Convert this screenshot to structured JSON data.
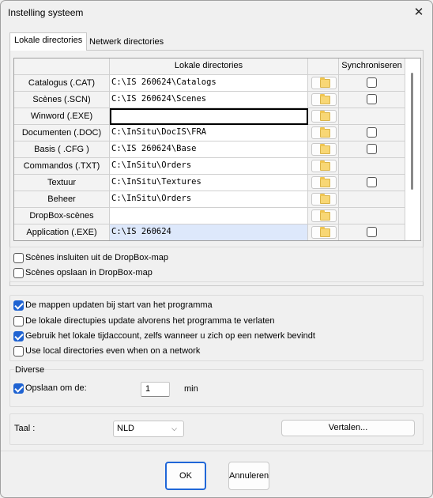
{
  "window": {
    "title": "Instelling systeem",
    "close_glyph": "✕"
  },
  "tabs": [
    {
      "label": "Lokale directories",
      "active": true
    },
    {
      "label": "Netwerk directories",
      "active": false
    }
  ],
  "grid": {
    "col_header_dirs": "Lokale directories",
    "col_header_sync": "Synchroniseren",
    "rows": [
      {
        "label": "Catalogus (.CAT)",
        "value": "C:\\IS 260624\\Catalogs",
        "sync": true
      },
      {
        "label": "Scènes (.SCN)",
        "value": "C:\\IS 260624\\Scenes",
        "sync": true
      },
      {
        "label": "Winword (.EXE)",
        "value": "",
        "sync": false
      },
      {
        "label": "Documenten (.DOC)",
        "value": "C:\\InSitu\\DocIS\\FRA",
        "sync": true
      },
      {
        "label": "Basis ( .CFG )",
        "value": "C:\\IS 260624\\Base",
        "sync": true
      },
      {
        "label": "Commandos (.TXT)",
        "value": "C:\\InSitu\\Orders",
        "sync": false
      },
      {
        "label": "Textuur",
        "value": "C:\\InSitu\\Textures",
        "sync": true
      },
      {
        "label": "Beheer",
        "value": "C:\\InSitu\\Orders",
        "sync": false
      },
      {
        "label": "DropBox-scènes",
        "value": "",
        "sync": false
      },
      {
        "label": "Application (.EXE)",
        "value": "C:\\IS 260624",
        "sync": true
      }
    ],
    "folder_icon": "folder-icon"
  },
  "dropbox": {
    "include_label": "Scènes insluiten uit de DropBox-map",
    "include_checked": false,
    "save_label": "Scènes opslaan in DropBox-map",
    "save_checked": false
  },
  "options": [
    {
      "label": "De mappen updaten bij start van het programma",
      "checked": true
    },
    {
      "label": "De lokale directupies update alvorens het programma te verlaten",
      "checked": false
    },
    {
      "label": "Gebruik het lokale tijdaccount, zelfs wanneer u zich op een netwerk bevindt",
      "checked": true
    },
    {
      "label": "Use local directories even when on a network",
      "checked": false
    }
  ],
  "misc": {
    "group_title": "Diverse",
    "save_every_label": "Opslaan om de:",
    "save_every_checked": true,
    "save_every_value": "1",
    "unit": "min"
  },
  "language": {
    "label": "Taal :",
    "selected": "NLD",
    "translate_button": "Vertalen..."
  },
  "footer": {
    "ok": "OK",
    "cancel": "Annuleren"
  },
  "colors": {
    "accent": "#1f63d2",
    "selection_bg": "#dde8fb",
    "folder": "#f8d775"
  }
}
